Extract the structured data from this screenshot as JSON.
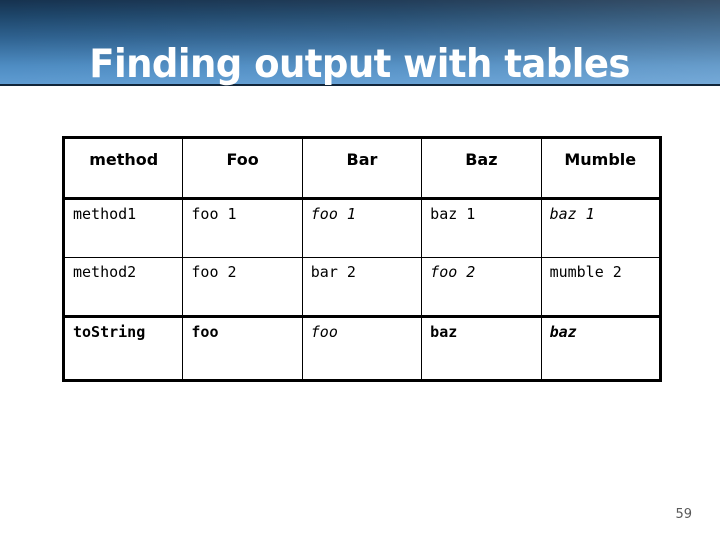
{
  "slide": {
    "title": "Finding output with tables",
    "page_number": "59",
    "header_gradient_top": "#16324f",
    "header_gradient_bottom": "#5f9cd2",
    "title_color": "#ffffff",
    "page_number_color": "#595959"
  },
  "table": {
    "headers": [
      "method",
      "Foo",
      "Bar",
      "Baz",
      "Mumble"
    ],
    "rows": [
      {
        "cells": [
          {
            "text": "method1",
            "style": "t-plain"
          },
          {
            "text": "foo 1",
            "style": "t-plain"
          },
          {
            "text": "foo 1",
            "style": "t-italic"
          },
          {
            "text": "baz 1",
            "style": "t-plain"
          },
          {
            "text": "baz 1",
            "style": "t-italic"
          }
        ]
      },
      {
        "cells": [
          {
            "text": "method2",
            "style": "t-plain"
          },
          {
            "text": "foo 2",
            "style": "t-plain"
          },
          {
            "text": "bar 2",
            "style": "t-plain"
          },
          {
            "text": "foo 2",
            "style": "t-italic"
          },
          {
            "text": "mumble 2",
            "style": "t-plain"
          }
        ]
      },
      {
        "cells": [
          {
            "text": "toString",
            "style": "t-bold"
          },
          {
            "text": "foo",
            "style": "t-bold"
          },
          {
            "text": "foo",
            "style": "t-italic"
          },
          {
            "text": "baz",
            "style": "t-bold"
          },
          {
            "text": "baz",
            "style": "t-bolditalic"
          }
        ]
      }
    ]
  }
}
